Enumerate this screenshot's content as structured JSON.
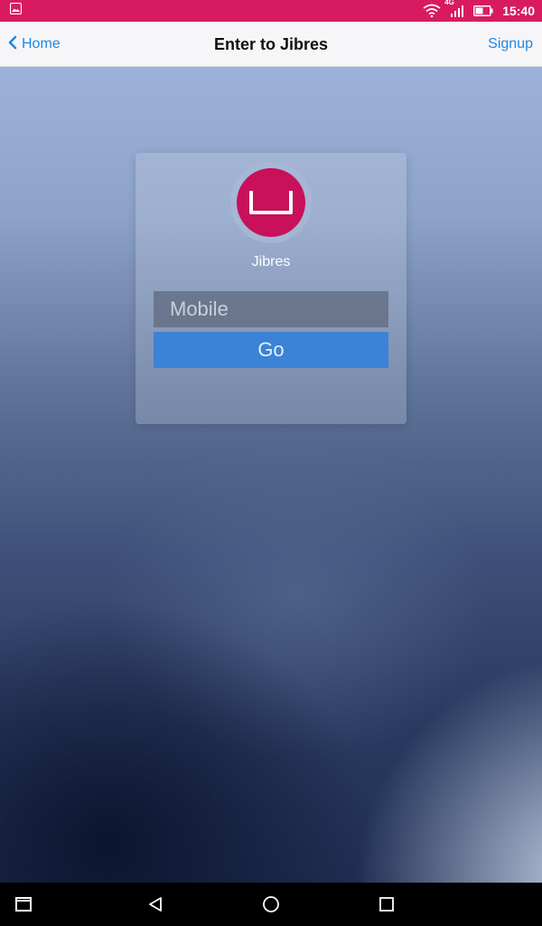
{
  "status_bar": {
    "time": "15:40",
    "network": "4G",
    "icons": [
      "image-icon",
      "wifi-icon",
      "signal-icon",
      "battery-icon"
    ],
    "color": "#d81b60"
  },
  "nav": {
    "back_label": "Home",
    "title": "Enter to Jibres",
    "signup_label": "Signup",
    "link_color": "#1e88e5"
  },
  "login": {
    "brand": "Jibres",
    "logo_color": "#c8115a",
    "mobile_placeholder": "Mobile",
    "mobile_value": "",
    "go_label": "Go",
    "button_color": "#3a83d6"
  },
  "system_nav": {
    "icons": [
      "recent-apps-icon",
      "back-icon",
      "home-icon",
      "overview-icon"
    ]
  }
}
